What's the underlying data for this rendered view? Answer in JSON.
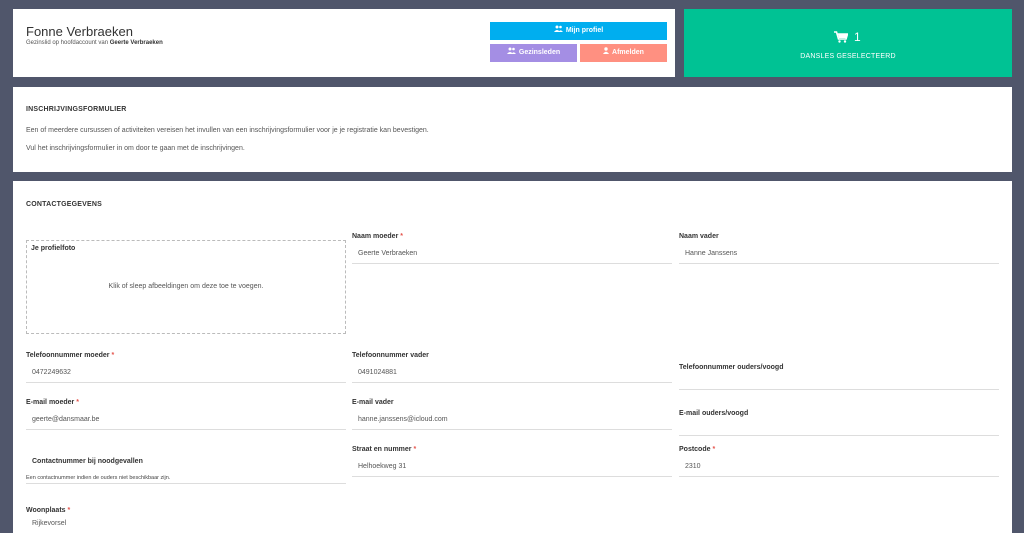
{
  "header": {
    "name": "Fonne Verbraeken",
    "sub_prefix": "Gezinslid op hoofdaccount van",
    "sub_owner": "Geerte Verbraeken",
    "btn_profile": "Mijn profiel",
    "btn_family": "Gezinsleden",
    "btn_logout": "Afmelden"
  },
  "cart": {
    "count": "1",
    "label": "DANSLES GESELECTEERD",
    "color": "#00c294"
  },
  "notice": {
    "title": "INSCHRIJVINGSFORMULIER",
    "line1": "Een of meerdere cursussen of activiteiten vereisen het invullen van een inschrijvingsformulier voor je je registratie kan bevestigen.",
    "line2": "Vul het inschrijvingsformulier in om door te gaan met de inschrijvingen."
  },
  "contact": {
    "title": "CONTACTGEGEVENS",
    "photo_label": "Je profielfoto",
    "photo_hint": "Klik of sleep afbeeldingen om deze toe te voegen.",
    "required_mark": "*",
    "fields": {
      "mother_name": {
        "label": "Naam moeder",
        "value": "Geerte Verbraeken"
      },
      "father_name": {
        "label": "Naam vader",
        "value": "Hanne Janssens"
      },
      "mother_phone": {
        "label": "Telefoonnummer moeder",
        "value": "0472249632"
      },
      "father_phone": {
        "label": "Telefoonnummer vader",
        "value": "0491024881"
      },
      "guardian_phone": {
        "label": "Telefoonnummer ouders/voogd",
        "value": ""
      },
      "mother_email": {
        "label": "E-mail moeder",
        "value": "geerte@dansmaar.be"
      },
      "father_email": {
        "label": "E-mail vader",
        "value": "hanne.janssens@icloud.com"
      },
      "guardian_email": {
        "label": "E-mail ouders/voogd",
        "value": ""
      },
      "emergency": {
        "label": "Contactnummer bij noodgevallen",
        "value": "",
        "help": "Een contactnummer indien de ouders niet beschikbaar zijn."
      },
      "street": {
        "label": "Straat en nummer",
        "value": "Helhoekweg 31"
      },
      "postcode": {
        "label": "Postcode",
        "value": "2310"
      },
      "city": {
        "label": "Woonplaats",
        "value": "Rijkevorsel"
      }
    }
  }
}
